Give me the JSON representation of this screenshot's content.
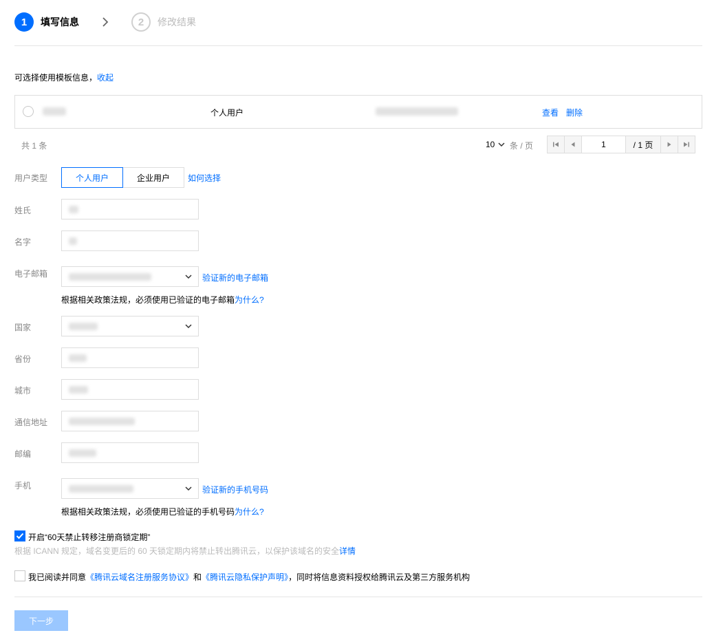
{
  "stepper": {
    "step1_num": "1",
    "step1_label": "填写信息",
    "step2_num": "2",
    "step2_label": "修改结果"
  },
  "template": {
    "prompt": "可选择使用模板信息，",
    "collapse_link": "收起",
    "row": {
      "user_type": "个人用户",
      "view": "查看",
      "delete": "删除"
    },
    "total": "共 1 条",
    "page_size": "10",
    "page_size_unit": "条 / 页",
    "page_current": "1",
    "page_total": "/ 1 页"
  },
  "form": {
    "user_type_label": "用户类型",
    "user_type_personal": "个人用户",
    "user_type_enterprise": "企业用户",
    "how_to_choose": "如何选择",
    "surname_label": "姓氏",
    "name_label": "名字",
    "email_label": "电子邮箱",
    "verify_email": "验证新的电子邮箱",
    "email_hint": "根据相关政策法规，必须使用已验证的电子邮箱",
    "email_why": "为什么?",
    "country_label": "国家",
    "province_label": "省份",
    "city_label": "城市",
    "address_label": "通信地址",
    "postcode_label": "邮编",
    "phone_label": "手机",
    "verify_phone": "验证新的手机号码",
    "phone_hint": "根据相关政策法规，必须使用已验证的手机号码",
    "phone_why": "为什么?"
  },
  "lock": {
    "label": "开启“60天禁止转移注册商锁定期”",
    "desc": "根据 ICANN 规定，域名变更后的 60 天锁定期内将禁止转出腾讯云，以保护该域名的安全",
    "detail": "详情",
    "checked": true
  },
  "agreement": {
    "prefix": "我已阅读并同意",
    "link1": "《腾讯云域名注册服务协议》",
    "and": "和",
    "link2": "《腾讯云隐私保护声明》",
    "suffix": "，同时将信息资料授权给腾讯云及第三方服务机构",
    "checked": false
  },
  "next_button": "下一步",
  "colors": {
    "accent": "#006eff",
    "disabled_button": "#9ac7ff"
  }
}
